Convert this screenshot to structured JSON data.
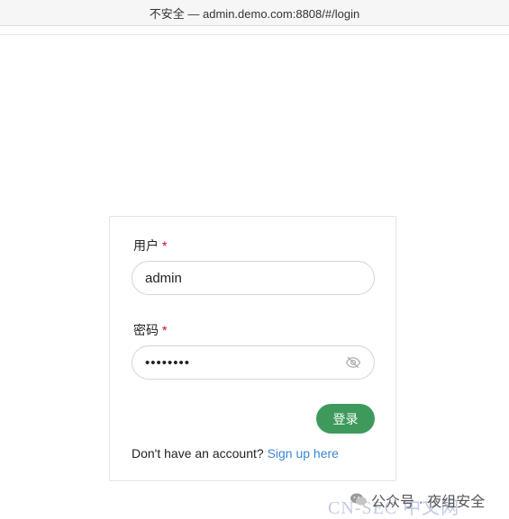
{
  "browser": {
    "address_text": "不安全 — admin.demo.com:8808/#/login"
  },
  "login_form": {
    "username_label": "用户",
    "required_mark": "*",
    "username_value": "admin",
    "password_label": "密码",
    "password_masked": "••••••••",
    "login_button": "登录",
    "signup_prompt": "Don't have an account?",
    "signup_link": "Sign up here"
  },
  "watermark": {
    "brand": "CN-SEC 中文网",
    "account": "公众号 · 夜组安全"
  },
  "icons": {
    "password_toggle": "eye-off-icon",
    "wechat": "wechat-icon"
  },
  "colors": {
    "primary_button": "#3e9a5c",
    "link": "#3a86d6",
    "required": "#d0021b"
  }
}
